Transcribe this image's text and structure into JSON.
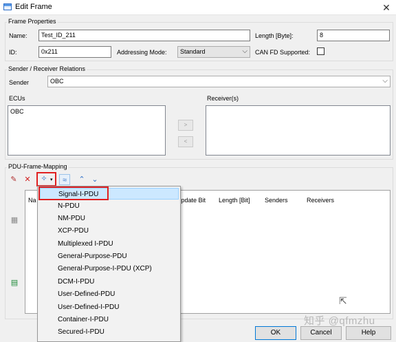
{
  "window": {
    "title": "Edit Frame",
    "close_glyph": "✕"
  },
  "frame_properties": {
    "group_label": "Frame Properties",
    "name_label": "Name:",
    "name_value": "Test_ID_211",
    "length_label": "Length [Byte]:",
    "length_value": "8",
    "id_label": "ID:",
    "id_value": "0x211",
    "addressing_label": "Addressing Mode:",
    "addressing_value": "Standard",
    "canfd_label": "CAN FD Supported:",
    "canfd_checked": false
  },
  "relations": {
    "group_label": "Sender / Receiver Relations",
    "sender_label": "Sender",
    "sender_value": "OBC",
    "ecus_label": "ECUs",
    "ecus_items": [
      "OBC"
    ],
    "receivers_label": "Receiver(s)",
    "add_label": ">",
    "remove_label": "<"
  },
  "mapping": {
    "group_label": "PDU-Frame-Mapping",
    "columns": [
      "Na",
      "Update Bit",
      "Length [Bit]",
      "Senders",
      "Receivers"
    ]
  },
  "pdu_menu": {
    "items": [
      "Signal-I-PDU",
      "N-PDU",
      "NM-PDU",
      "XCP-PDU",
      "Multiplexed I-PDU",
      "General-Purpose-PDU",
      "General-Purpose-I-PDU (XCP)",
      "DCM-I-PDU",
      "User-Defined-PDU",
      "User-Defined-I-PDU",
      "Container-I-PDU",
      "Secured-I-PDU"
    ],
    "selected_index": 0
  },
  "buttons": {
    "ok": "OK",
    "cancel": "Cancel",
    "help": "Help"
  },
  "watermark": "知乎 @qfmzhu",
  "colors": {
    "highlight_red": "#e02020",
    "menu_selected": "#cce8ff",
    "accent_blue": "#0078d7"
  }
}
